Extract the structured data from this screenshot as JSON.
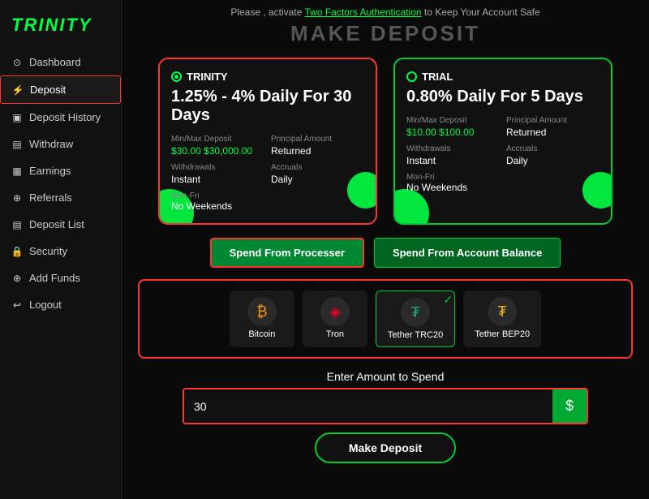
{
  "app": {
    "logo": "TRINITY"
  },
  "topbar": {
    "message": "Please , activate ",
    "link_text": "Two Factors Authentication",
    "message2": " to Keep Your Account Safe"
  },
  "page": {
    "title": "MAKE DEPOSIT"
  },
  "sidebar": {
    "items": [
      {
        "id": "dashboard",
        "label": "Dashboard",
        "icon": "⊙"
      },
      {
        "id": "deposit",
        "label": "Deposit",
        "icon": "⚡",
        "active": true
      },
      {
        "id": "deposit-history",
        "label": "Deposit History",
        "icon": "▣"
      },
      {
        "id": "withdraw",
        "label": "Withdraw",
        "icon": "▤"
      },
      {
        "id": "earnings",
        "label": "Earnings",
        "icon": "▦"
      },
      {
        "id": "referrals",
        "label": "Referrals",
        "icon": "⊕"
      },
      {
        "id": "deposit-list",
        "label": "Deposit List",
        "icon": "▤"
      },
      {
        "id": "security",
        "label": "Security",
        "icon": "🔒"
      },
      {
        "id": "add-funds",
        "label": "Add Funds",
        "icon": "⊕"
      },
      {
        "id": "logout",
        "label": "Logout",
        "icon": "↩"
      }
    ]
  },
  "plans": [
    {
      "id": "trinity",
      "name": "TRINITY",
      "rate": "1.25% - 4% Daily For 30 Days",
      "min_deposit_label": "Min/Max Deposit",
      "min_deposit": "$30.00 $30,000.00",
      "principal_label": "Principal Amount",
      "principal": "Returned",
      "withdrawals_label": "Withdrawals",
      "withdrawals": "Instant",
      "accruals_label": "Accruals",
      "accruals": "Daily",
      "schedule_label": "Mon-Fri",
      "schedule": "No Weekends",
      "selected": true
    },
    {
      "id": "trial",
      "name": "TRIAL",
      "rate": "0.80% Daily For 5 Days",
      "min_deposit_label": "Min/Max Deposit",
      "min_deposit": "$10.00 $100.00",
      "principal_label": "Principal Amount",
      "principal": "Returned",
      "withdrawals_label": "Withdrawals",
      "withdrawals": "Instant",
      "accruals_label": "Accruals",
      "accruals": "Daily",
      "schedule_label": "Mon-Fri",
      "schedule": "No Weekends",
      "selected": false
    }
  ],
  "buttons": {
    "spend_processor": "Spend From Processer",
    "spend_balance": "Spend From Account Balance"
  },
  "payment_methods": [
    {
      "id": "bitcoin",
      "label": "Bitcoin",
      "icon": "₿",
      "color": "#f7931a",
      "selected": false
    },
    {
      "id": "tron",
      "label": "Tron",
      "icon": "◈",
      "color": "#ef0027",
      "selected": false
    },
    {
      "id": "tether-trc20",
      "label": "Tether TRC20",
      "icon": "₮",
      "color": "#26a17b",
      "selected": true
    },
    {
      "id": "tether-bep20",
      "label": "Tether BEP20",
      "icon": "₮",
      "color": "#f0b90b",
      "selected": false
    }
  ],
  "amount": {
    "label": "Enter Amount to Spend",
    "value": "30",
    "placeholder": "30",
    "btn_icon": "$"
  },
  "deposit_button": {
    "label": "Make Deposit"
  }
}
